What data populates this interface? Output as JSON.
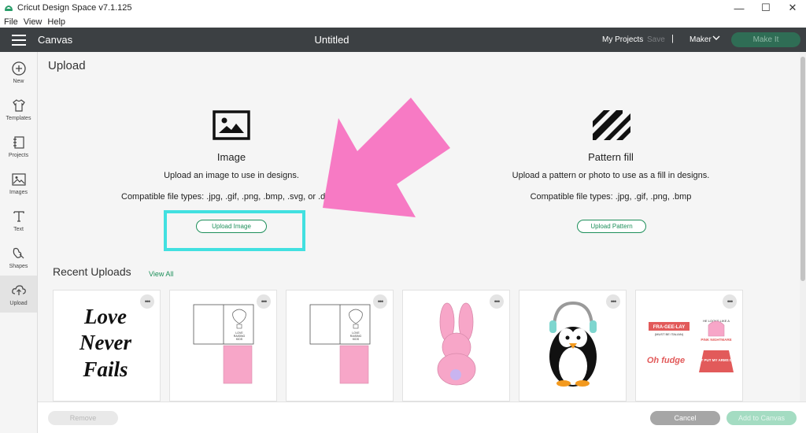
{
  "window": {
    "title": "Cricut Design Space  v7.1.125",
    "minimize": "—",
    "maximize": "☐",
    "close": "✕"
  },
  "menu": [
    "File",
    "View",
    "Help"
  ],
  "header": {
    "canvas_label": "Canvas",
    "document_title": "Untitled",
    "my_projects": "My Projects",
    "save": "Save",
    "separator": "|",
    "machine": "Maker",
    "make_it": "Make It"
  },
  "sidebar": [
    {
      "label": "New",
      "icon": "plus-circle-icon"
    },
    {
      "label": "Templates",
      "icon": "tshirt-icon"
    },
    {
      "label": "Projects",
      "icon": "projects-icon"
    },
    {
      "label": "Images",
      "icon": "image-icon"
    },
    {
      "label": "Text",
      "icon": "text-t-icon"
    },
    {
      "label": "Shapes",
      "icon": "shapes-icon"
    },
    {
      "label": "Upload",
      "icon": "upload-cloud-icon"
    }
  ],
  "main": {
    "page_title": "Upload",
    "image_section": {
      "title": "Image",
      "description": "Upload an image to use in designs.",
      "file_types": "Compatible file types: .jpg, .gif, .png, .bmp, .svg, or .dxf",
      "button": "Upload Image"
    },
    "pattern_section": {
      "title": "Pattern fill",
      "description": "Upload a pattern or photo to use as a fill in designs.",
      "file_types": "Compatible file types: .jpg, .gif, .png, .bmp",
      "button": "Upload Pattern"
    },
    "recent": {
      "title": "Recent Uploads",
      "view_all": "View All",
      "more_glyph": "•••",
      "items": [
        {
          "name": "love-never-fails",
          "text_lines": [
            "Love",
            "Never",
            "Fails"
          ]
        },
        {
          "name": "hot-air-balloon-card",
          "text_lines": [
            "LOVE",
            "RAISING",
            "KIDS"
          ]
        },
        {
          "name": "hot-air-balloon-card-2",
          "text_lines": [
            "LOVE",
            "RAISING",
            "KIDS"
          ]
        },
        {
          "name": "pink-bunny",
          "text_lines": []
        },
        {
          "name": "penguin-headphones",
          "text_lines": []
        },
        {
          "name": "christmas-sweater-sayings",
          "text_lines": [
            "FRA-GEE-LAY",
            "(MUST BE ITALIAN)",
            "HE LOOKS LIKE A",
            "PINK NIGHTMARE",
            "Oh fudge",
            "I CAN'T PUT MY ARMS DOWN!"
          ]
        }
      ]
    }
  },
  "footer": {
    "remove": "Remove",
    "cancel": "Cancel",
    "add_to_canvas": "Add to Canvas"
  },
  "colors": {
    "header_bg": "#3c4043",
    "accent_green": "#1d8f5a",
    "highlight_cyan": "#42e0e0",
    "arrow_pink": "#f77ac4"
  }
}
